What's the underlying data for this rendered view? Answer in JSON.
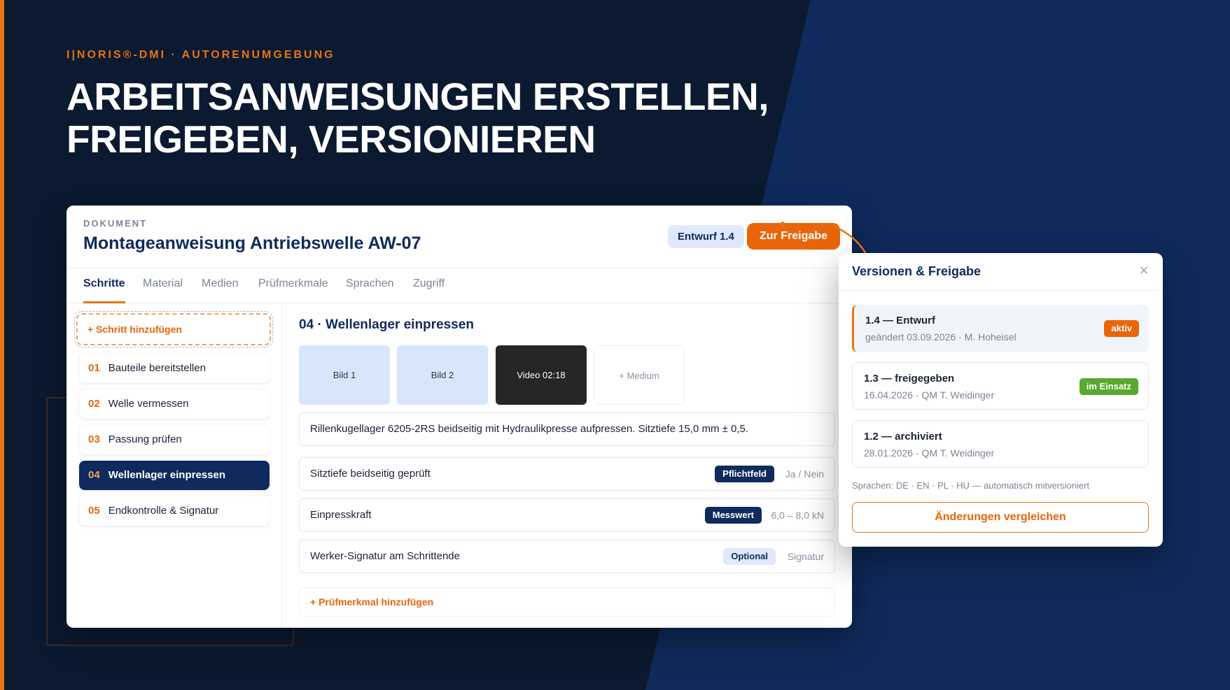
{
  "hero": {
    "eyebrow": "I|NORIS®-DMI · AUTORENUMGEBUNG",
    "headline_line1": "ARBEITSANWEISUNGEN ERSTELLEN,",
    "headline_line2": "FREIGEBEN, VERSIONIEREN"
  },
  "document": {
    "label": "DOKUMENT",
    "title": "Montageanweisung Antriebswelle AW-07",
    "draft_badge": "Entwurf 1.4",
    "release_button": "Zur Freigabe"
  },
  "tabs": [
    {
      "label": "Schritte",
      "active": true
    },
    {
      "label": "Material"
    },
    {
      "label": "Medien"
    },
    {
      "label": "Prüfmerkmale"
    },
    {
      "label": "Sprachen"
    },
    {
      "label": "Zugriff"
    }
  ],
  "steps": {
    "add_label": "+ Schritt hinzufügen",
    "items": [
      {
        "num": "01",
        "label": "Bauteile bereitstellen"
      },
      {
        "num": "02",
        "label": "Welle vermessen"
      },
      {
        "num": "03",
        "label": "Passung prüfen"
      },
      {
        "num": "04",
        "label": "Wellenlager einpressen",
        "active": true
      },
      {
        "num": "05",
        "label": "Endkontrolle & Signatur"
      }
    ]
  },
  "detail": {
    "title": "04 · Wellenlager einpressen",
    "media": [
      "Bild 1",
      "Bild 2",
      "Video 02:18",
      "+ Medium"
    ],
    "description": "Rillenkugellager 6205-2RS beidseitig mit Hydraulikpresse aufpressen. Sitztiefe 15,0 mm ± 0,5.",
    "features": [
      {
        "label": "Sitztiefe beidseitig geprüft",
        "badge": "Pflichtfeld",
        "hint": "Ja / Nein"
      },
      {
        "label": "Einpresskraft",
        "badge": "Messwert",
        "hint": "6,0 – 8,0 kN"
      },
      {
        "label": "Werker-Signatur am Schrittende",
        "badge": "Optional",
        "hint": "Signatur"
      }
    ],
    "add_feature": "+ Prüfmerkmal hinzufügen"
  },
  "versions": {
    "title": "Versionen & Freigabe",
    "items": [
      {
        "title": "1.4 — Entwurf",
        "meta": "geändert 03.09.2026 · M. Hoheisel",
        "badge": "aktiv"
      },
      {
        "title": "1.3 — freigegeben",
        "meta": "16.04.2026 · QM T. Weidinger",
        "badge": "im Einsatz"
      },
      {
        "title": "1.2 — archiviert",
        "meta": "28.01.2026 · QM T. Weidinger"
      }
    ],
    "languages_note": "Sprachen: DE · EN · PL · HU — automatisch mitversioniert",
    "compare_button": "Änderungen vergleichen"
  },
  "colors": {
    "accent": "#e8730f",
    "navy": "#0f2a5c",
    "background": "#0b1a31",
    "success": "#5aa92f"
  }
}
